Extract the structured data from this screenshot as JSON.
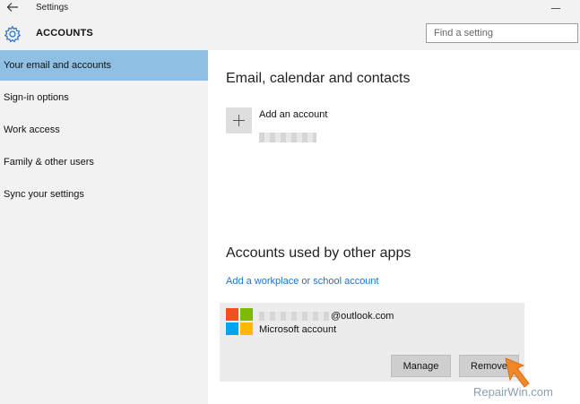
{
  "window": {
    "title": "Settings"
  },
  "header": {
    "title": "ACCOUNTS",
    "search_placeholder": "Find a setting"
  },
  "sidebar": {
    "items": [
      {
        "label": "Your email and accounts",
        "selected": true
      },
      {
        "label": "Sign-in options",
        "selected": false
      },
      {
        "label": "Work access",
        "selected": false
      },
      {
        "label": "Family & other users",
        "selected": false
      },
      {
        "label": "Sync your settings",
        "selected": false
      }
    ]
  },
  "main": {
    "email_section": {
      "title": "Email, calendar and contacts",
      "add_account_label": "Add an account"
    },
    "apps_section": {
      "title": "Accounts used by other apps",
      "add_link": "Add a workplace or school account",
      "account": {
        "email_suffix": "@outlook.com",
        "type": "Microsoft account",
        "manage_label": "Manage",
        "remove_label": "Remove"
      }
    }
  },
  "watermark": "RepairWin.com",
  "colors": {
    "accent_selected": "#90bfe4",
    "link": "#1a73c9",
    "ms_red": "#f25022",
    "ms_green": "#7fba00",
    "ms_blue": "#00a4ef",
    "ms_yellow": "#ffb900",
    "cursor": "#f0882a"
  },
  "icons": {
    "back": "back-arrow-icon",
    "gear": "gear-icon",
    "plus": "plus-icon",
    "microsoft": "microsoft-logo-icon",
    "cursor": "mouse-cursor-icon"
  }
}
